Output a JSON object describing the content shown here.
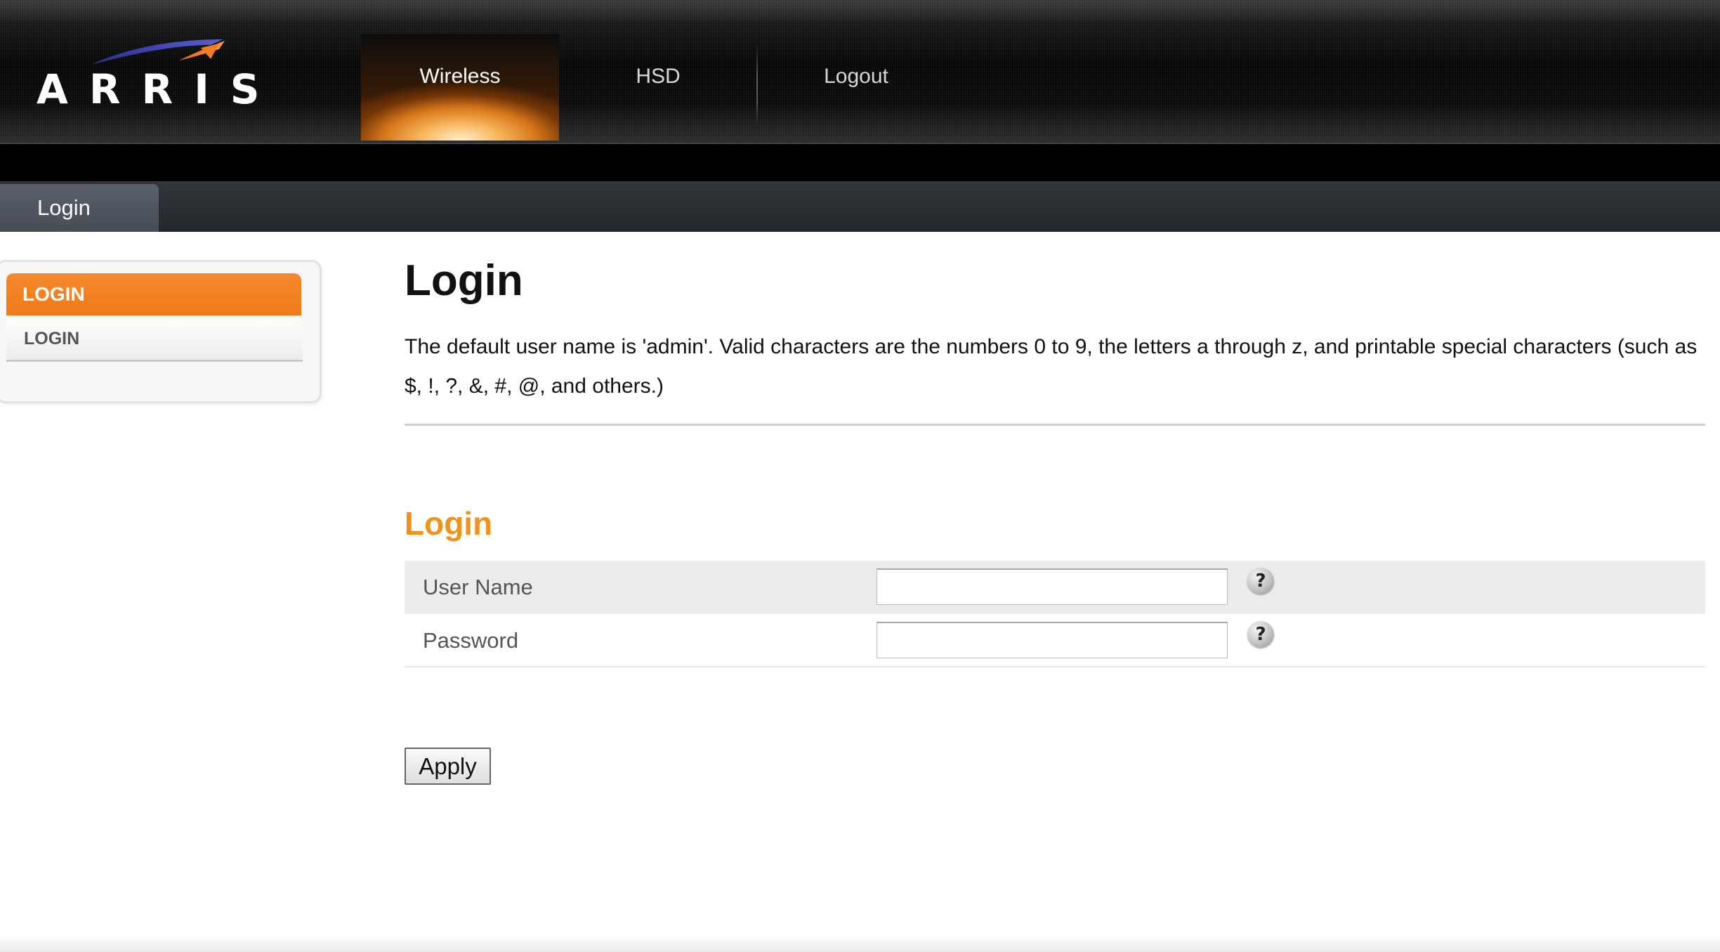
{
  "header": {
    "logo_text": "ARRIS",
    "nav": [
      {
        "label": "Wireless",
        "active": true
      },
      {
        "label": "HSD",
        "active": false
      },
      {
        "label": "Logout",
        "active": false
      }
    ]
  },
  "breadcrumb": {
    "tab_label": "Login"
  },
  "sidebar": {
    "heading": "LOGIN",
    "items": [
      {
        "label": "LOGIN"
      }
    ]
  },
  "main": {
    "title": "Login",
    "description": "The default user name is 'admin'. Valid characters are the numbers 0 to 9, the letters a through z, and printable special characters (such as $, !, ?, &, #, @, and others.)",
    "section_title": "Login",
    "fields": [
      {
        "label": "User Name",
        "value": "",
        "help_icon": "help-icon",
        "help_glyph": "?"
      },
      {
        "label": "Password",
        "value": "",
        "help_icon": "help-icon",
        "help_glyph": "?"
      }
    ],
    "apply_label": "Apply"
  },
  "colors": {
    "accent_orange": "#f07a19",
    "section_title_orange": "#f0921c",
    "header_dark": "#050505"
  }
}
